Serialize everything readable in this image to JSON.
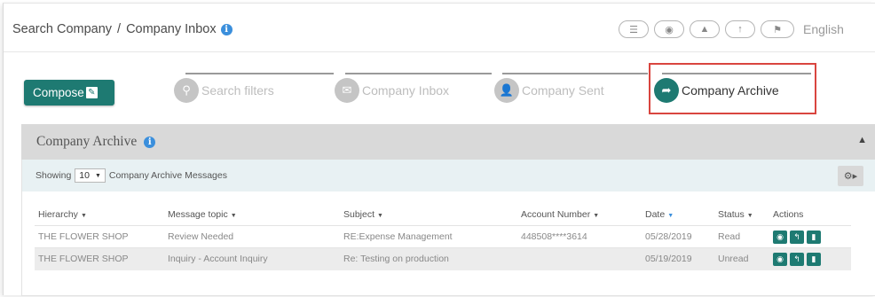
{
  "breadcrumb": {
    "root": "Search Company",
    "separator": "/",
    "current": "Company Inbox"
  },
  "top_icons": [
    {
      "name": "list-icon",
      "glyph": "☰"
    },
    {
      "name": "user-icon",
      "glyph": "◉"
    },
    {
      "name": "bell-icon",
      "glyph": "▲"
    },
    {
      "name": "upload-icon",
      "glyph": "↑"
    },
    {
      "name": "flag-icon",
      "glyph": "⚑"
    }
  ],
  "language": "English",
  "compose": {
    "label": "Compose",
    "icon": "✎"
  },
  "steps": [
    {
      "label": "Search filters",
      "icon": "search-icon",
      "glyph": "⚲",
      "active": false
    },
    {
      "label": "Company Inbox",
      "icon": "envelope-icon",
      "glyph": "✉",
      "active": false
    },
    {
      "label": "Company Sent",
      "icon": "person-icon",
      "glyph": "👤",
      "active": false
    },
    {
      "label": "Company Archive",
      "icon": "archive-icon",
      "glyph": "➦",
      "active": true
    }
  ],
  "panel": {
    "title": "Company Archive",
    "showing_prefix": "Showing",
    "page_size": "10",
    "showing_suffix": "Company Archive Messages"
  },
  "table": {
    "columns": [
      "Hierarchy",
      "Message topic",
      "Subject",
      "Account Number",
      "Date",
      "Status",
      "Actions"
    ],
    "rows": [
      {
        "hierarchy": "THE FLOWER SHOP",
        "topic": "Review Needed",
        "subject": "RE:Expense Management",
        "account": "448508****3614",
        "date": "05/28/2019",
        "status": "Read"
      },
      {
        "hierarchy": "THE FLOWER SHOP",
        "topic": "Inquiry - Account Inquiry",
        "subject": "Re: Testing on production",
        "account": "",
        "date": "05/19/2019",
        "status": "Unread"
      }
    ]
  },
  "colors": {
    "accent": "#1e7a72",
    "highlight": "#d9453f",
    "info": "#3b8fdc"
  }
}
